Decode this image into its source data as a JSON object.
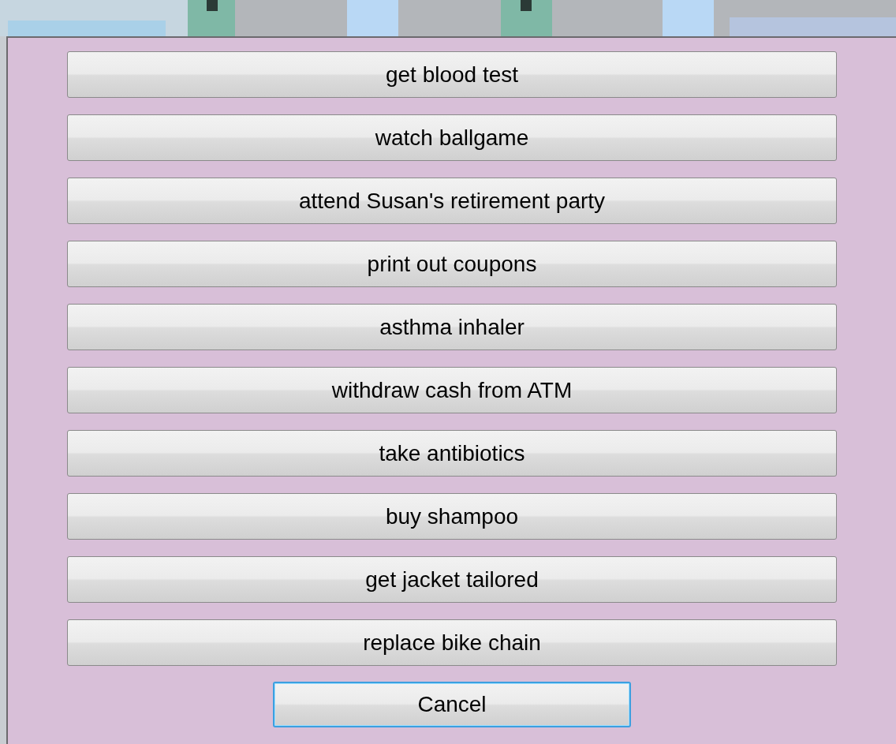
{
  "choices": [
    {
      "label": "get blood test"
    },
    {
      "label": "watch ballgame"
    },
    {
      "label": "attend Susan's retirement party"
    },
    {
      "label": "print out coupons"
    },
    {
      "label": "asthma inhaler"
    },
    {
      "label": "withdraw cash from ATM"
    },
    {
      "label": "take antibiotics"
    },
    {
      "label": "buy shampoo"
    },
    {
      "label": "get jacket tailored"
    },
    {
      "label": "replace bike chain"
    }
  ],
  "cancel": {
    "label": "Cancel",
    "focused": true
  }
}
